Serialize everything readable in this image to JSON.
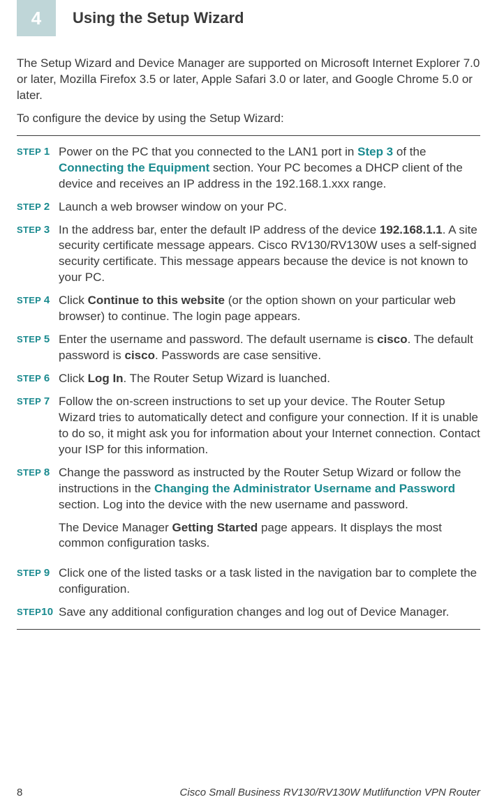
{
  "sectionNumber": "4",
  "sectionTitle": "Using the Setup Wizard",
  "intro1": "The Setup Wizard and Device Manager are supported on Microsoft Internet Explorer 7.0 or later, Mozilla Firefox 3.5 or later, Apple Safari 3.0 or later, and Google Chrome 5.0 or later.",
  "intro2": "To configure the device by using the Setup Wizard:",
  "stepWord": "STEP",
  "steps": {
    "s1num": "1",
    "s1a": "Power on the PC that you connected to the LAN1 port in ",
    "s1_xref1": "Step 3",
    "s1b": " of the ",
    "s1_xref2": "Connecting the Equipment",
    "s1c": " section. Your PC becomes a DHCP client of the device and receives an IP address in the 192.168.1.xxx range.",
    "s2num": "2",
    "s2": "Launch a web browser window on your PC.",
    "s3num": "3",
    "s3a": "In the address bar, enter the default IP address of the device ",
    "s3_bold": "192.168.1.1",
    "s3b": ". A site security certificate message appears. Cisco RV130/RV130W  uses a self-signed security certificate. This message appears because the device is not known to your PC.",
    "s4num": "4",
    "s4a": "Click ",
    "s4_bold": "Continue to this website",
    "s4b": " (or the option shown on your particular web browser) to continue. The login page appears.",
    "s5num": "5",
    "s5a": "Enter the username and password. The default username is ",
    "s5_bold1": "cisco",
    "s5b": ". The default password is ",
    "s5_bold2": "cisco",
    "s5c": ". Passwords are case sensitive.",
    "s6num": "6",
    "s6a": "Click ",
    "s6_bold": "Log In",
    "s6b": ". The Router Setup Wizard is luanched.",
    "s7num": "7",
    "s7": "Follow the on-screen instructions to set up your device. The Router Setup Wizard tries to automatically detect and configure your connection. If it is unable to do so, it might ask you for  information about your Internet connection. Contact your ISP for this information.",
    "s8num": "8",
    "s8a": "Change the password as instructed by the Router Setup Wizard or follow the instructions in the ",
    "s8_xref": "Changing the Administrator Username and Password",
    "s8b": " section. Log into the device with the new username and password.",
    "s8p2a": "The Device Manager ",
    "s8p2_bold": "Getting Started",
    "s8p2b": " page appears. It displays the most common configuration tasks.",
    "s9num": "9",
    "s9": "Click one of the listed tasks or a task listed in the navigation bar to complete the configuration.",
    "s10num": "10",
    "s10": "Save any additional configuration changes and log out of Device Manager."
  },
  "pageNumber": "8",
  "footerText": "Cisco Small Business RV130/RV130W Mutlifunction VPN Router"
}
